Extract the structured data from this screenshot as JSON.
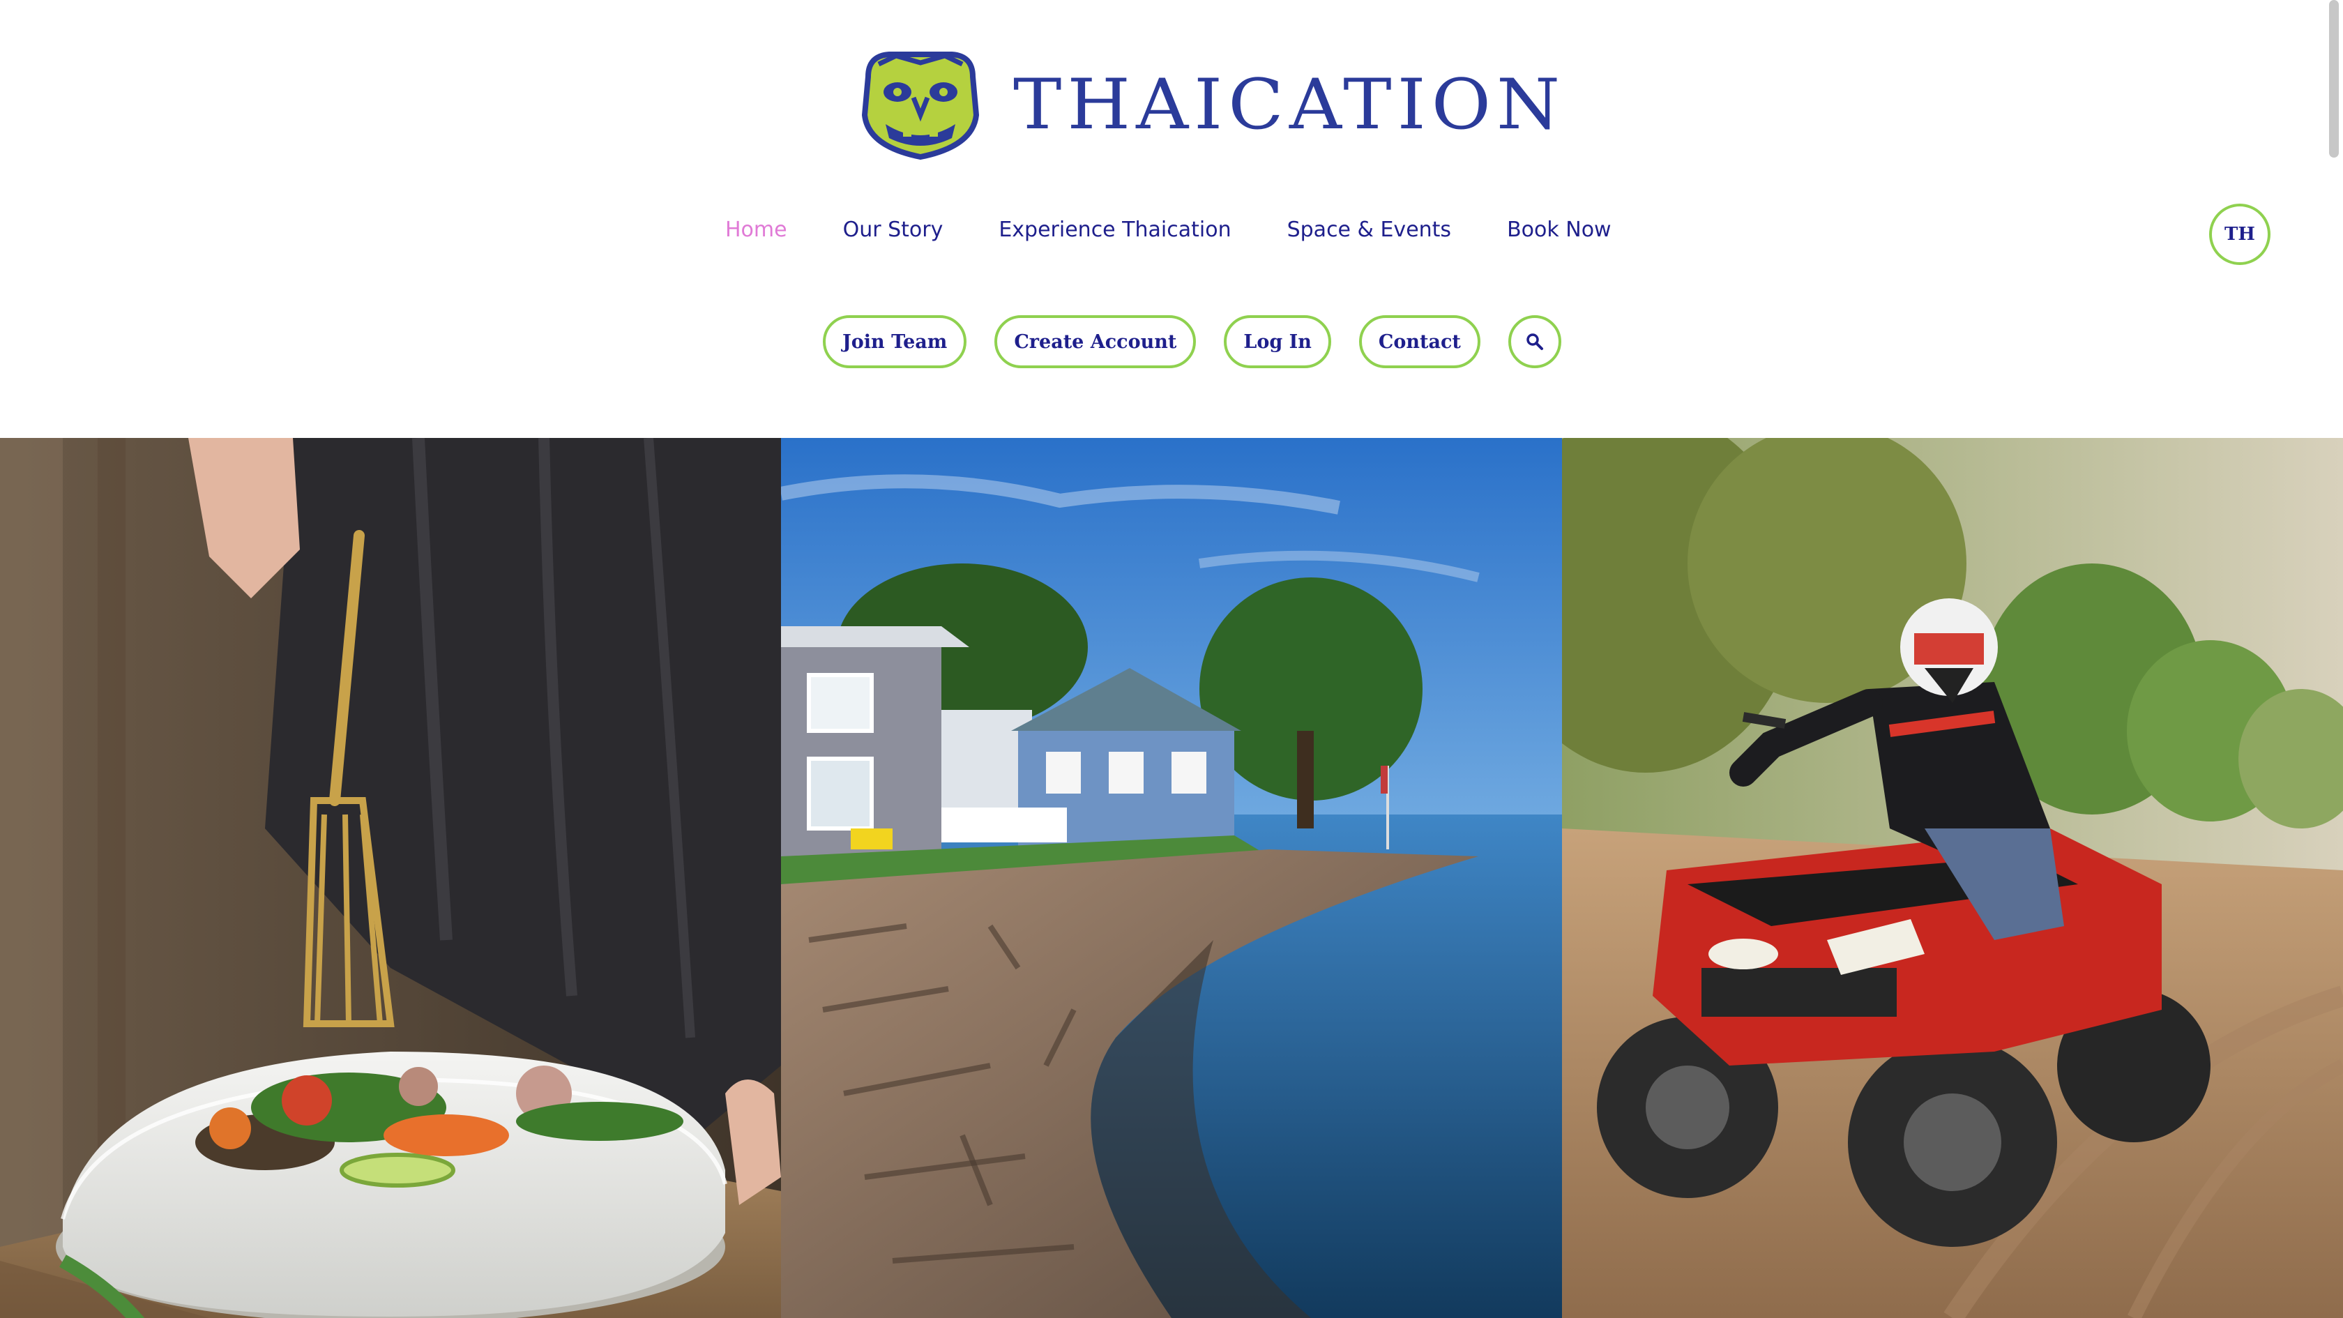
{
  "brand": {
    "name": "THAICATION",
    "logo_icon": "thai-mask-icon",
    "colors": {
      "primary": "#2b3b9a",
      "accent": "#8fd14f",
      "active": "#e07ad6"
    }
  },
  "nav": {
    "items": [
      {
        "label": "Home",
        "active": true
      },
      {
        "label": "Our Story",
        "active": false
      },
      {
        "label": "Experience Thaication",
        "active": false
      },
      {
        "label": "Space & Events",
        "active": false
      },
      {
        "label": "Book Now",
        "active": false
      }
    ],
    "language": "TH"
  },
  "actions": {
    "join_team": "Join Team",
    "create_account": "Create Account",
    "log_in": "Log In",
    "contact": "Contact",
    "search_icon": "search-icon"
  },
  "hero": {
    "panels": [
      {
        "subject": "plated salad with fork"
      },
      {
        "subject": "coastal houses by the sea"
      },
      {
        "subject": "rider on red ATV"
      }
    ]
  }
}
